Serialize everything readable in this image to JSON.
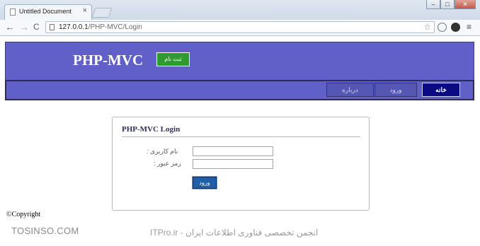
{
  "browser": {
    "tab_title": "Untitled Document",
    "tab_close": "×",
    "url_host": "127.0.0.1",
    "url_path": "/PHP-MVC/Login",
    "back_glyph": "←",
    "forward_glyph": "→",
    "reload_glyph": "C",
    "star_glyph": "☆",
    "menu_glyph": "≡",
    "window_controls": [
      "–",
      "□",
      "✕"
    ]
  },
  "header": {
    "logo": "PHP-MVC",
    "register_label": "ثبت نام"
  },
  "nav": {
    "items": [
      {
        "label": "خانه",
        "active": true
      },
      {
        "label": "ورود",
        "active": false
      },
      {
        "label": "درباره",
        "active": false
      }
    ]
  },
  "login": {
    "title": "PHP-MVC Login",
    "username_label": "نام کاربری :",
    "password_label": "رمز عبور :",
    "username_value": "",
    "password_value": "",
    "submit_label": "ورود"
  },
  "footer": {
    "copyright": "©Copyright"
  },
  "watermark": {
    "left": "TOSINSO.COM",
    "right": "ITPro.ir - انجمن تخصصی فناوری اطلاعات ایران"
  },
  "colors": {
    "header_bg": "#6060c8",
    "active_nav_bg": "#0a0a82",
    "register_btn": "#2f9a2f",
    "login_btn": "#1f5fa8"
  },
  "icons": {
    "tab_favicon": "page-icon",
    "address_page": "page-icon",
    "globe": "globe-icon",
    "extension": "extension-icon"
  }
}
